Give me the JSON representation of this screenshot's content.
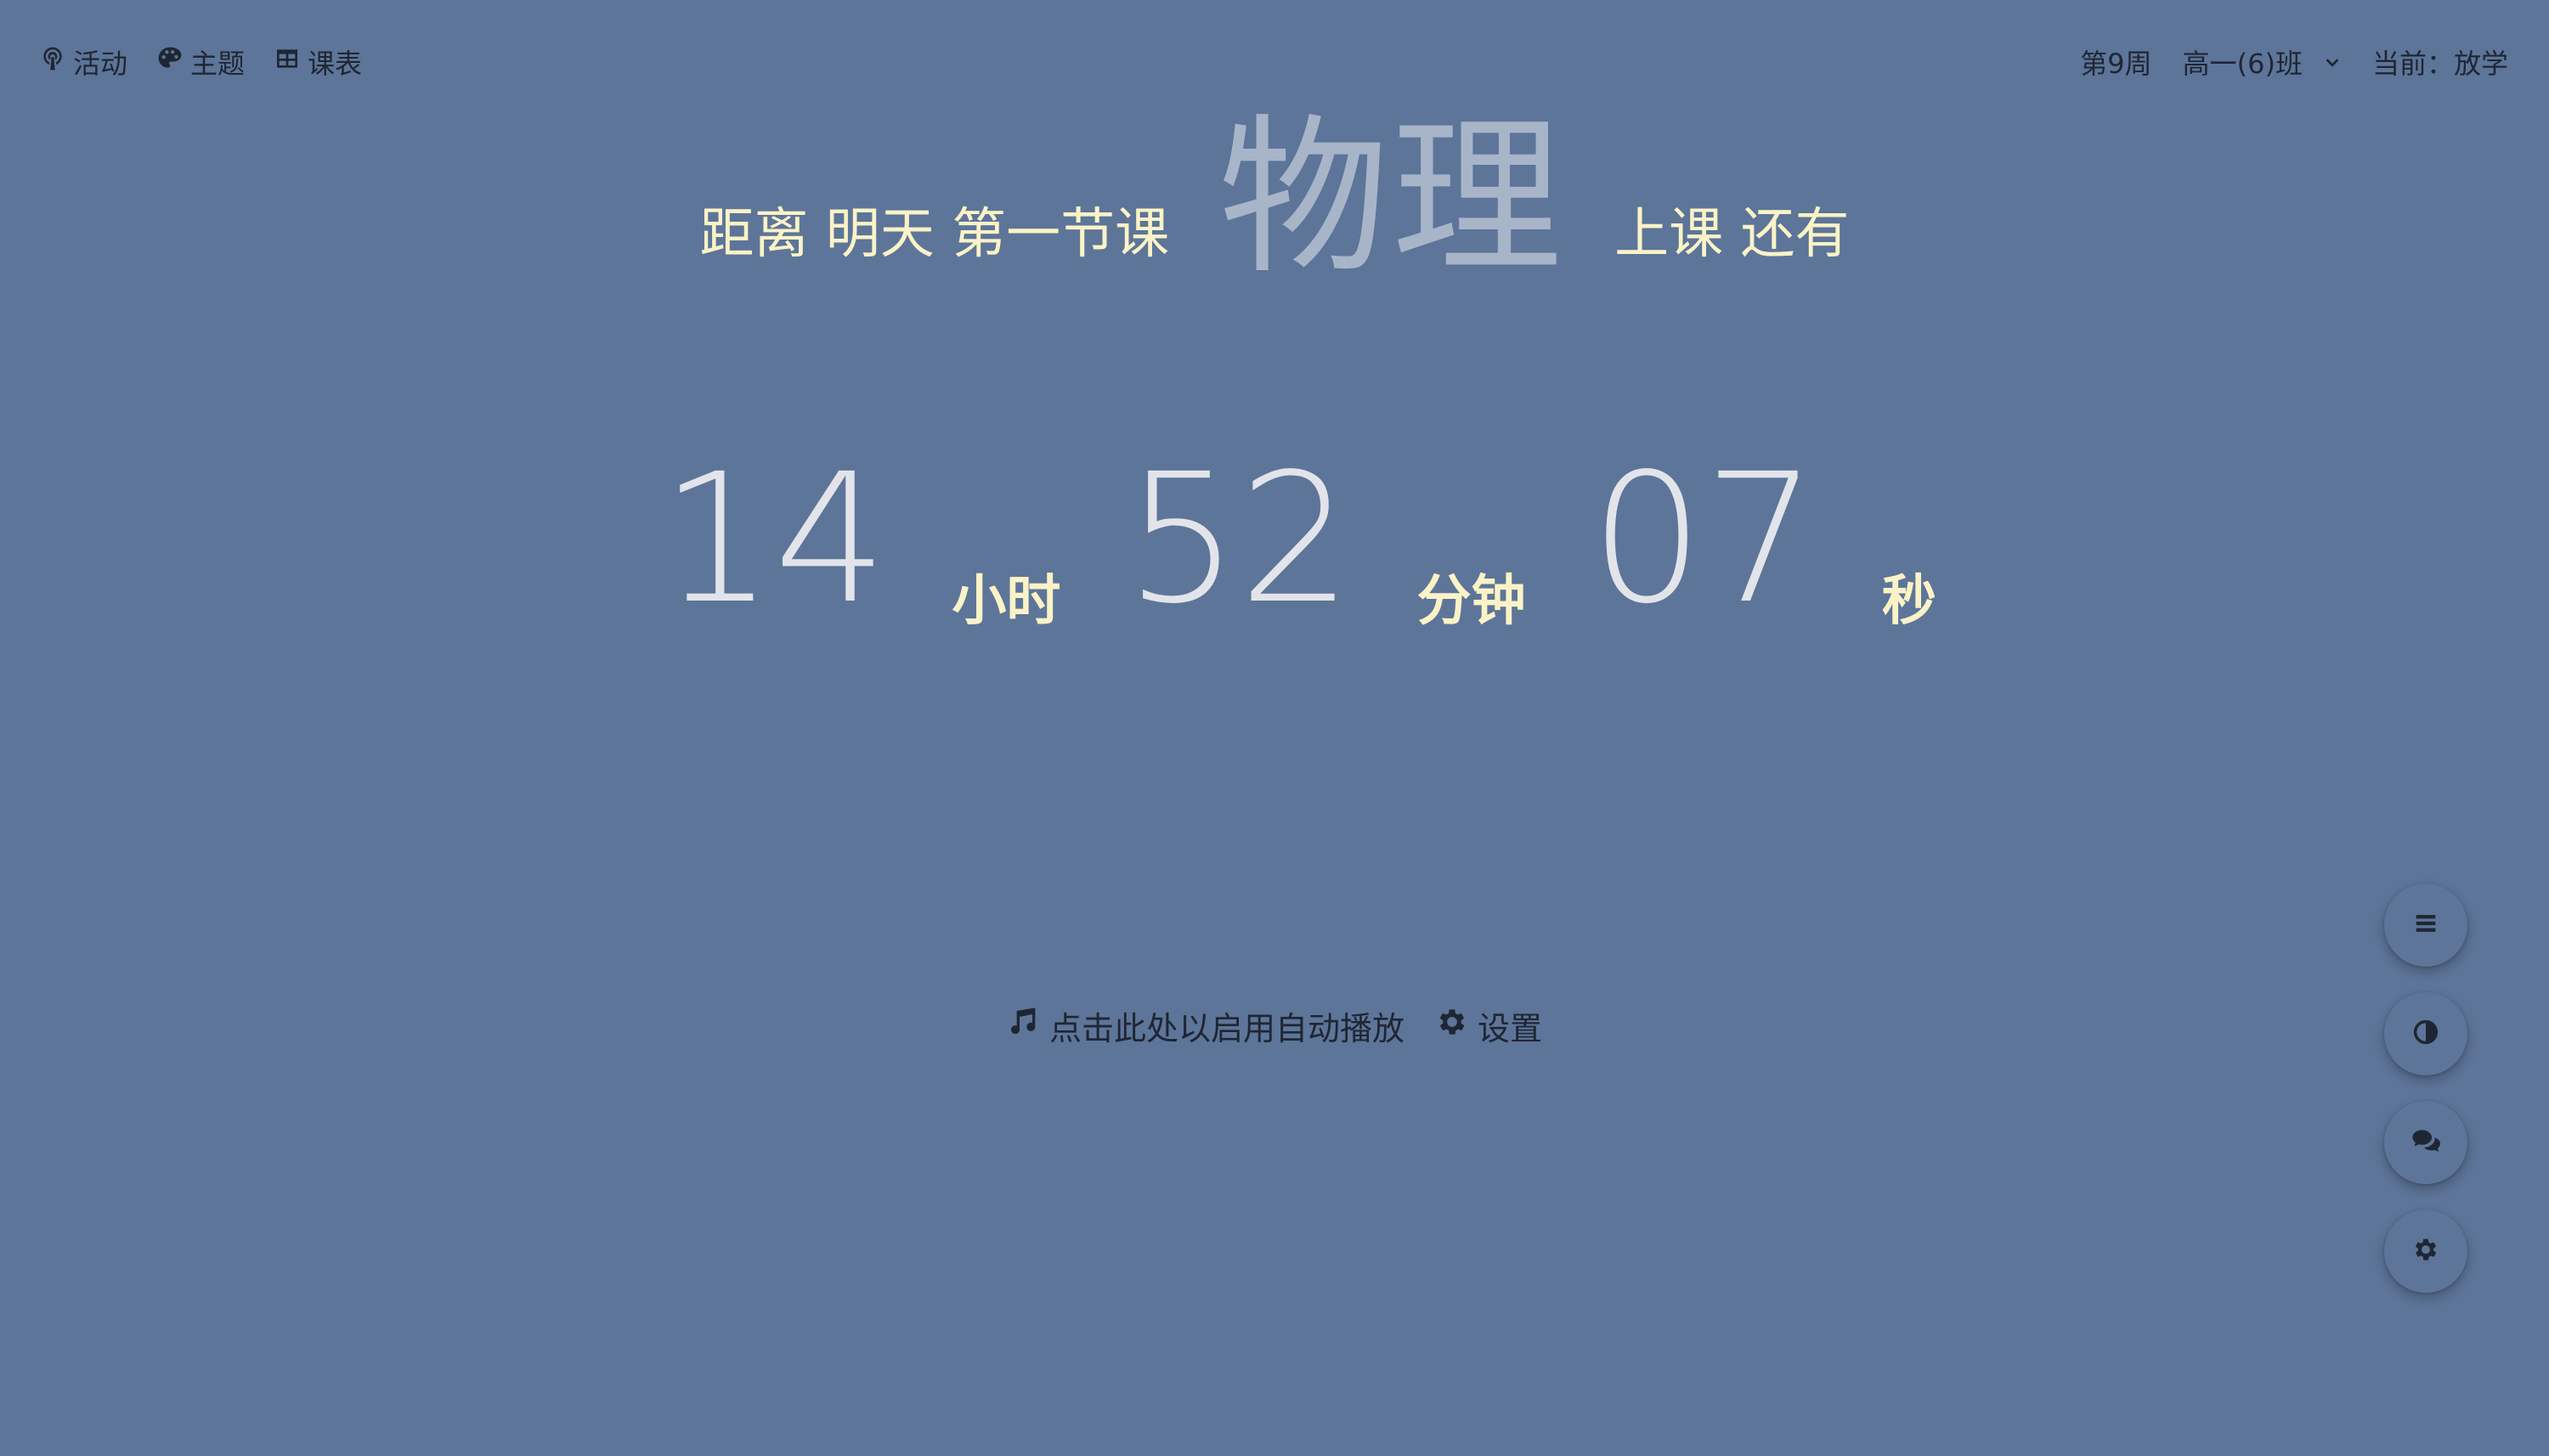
{
  "nav": {
    "activity_label": "活动",
    "theme_label": "主题",
    "schedule_label": "课表"
  },
  "status": {
    "week": "第9周",
    "class_name": "高一(6)班",
    "current": "当前：放学"
  },
  "heading": {
    "prefix": "距离 明天 第一节课",
    "subject": "物理",
    "suffix": "上课 还有"
  },
  "countdown": {
    "hours": "14",
    "hours_unit": "小时",
    "minutes": "52",
    "minutes_unit": "分钟",
    "seconds": "07",
    "seconds_unit": "秒"
  },
  "actions": {
    "autoplay_label": "点击此处以启用自动播放",
    "settings_label": "设置"
  },
  "fab": {
    "icons": [
      "menu-icon",
      "contrast-icon",
      "chat-icon",
      "gear-icon"
    ]
  },
  "colors": {
    "background": "#5d7599",
    "accent_text": "#fbf3c7",
    "subject": "#a8b5c9",
    "numbers": "#e2e4ea"
  }
}
